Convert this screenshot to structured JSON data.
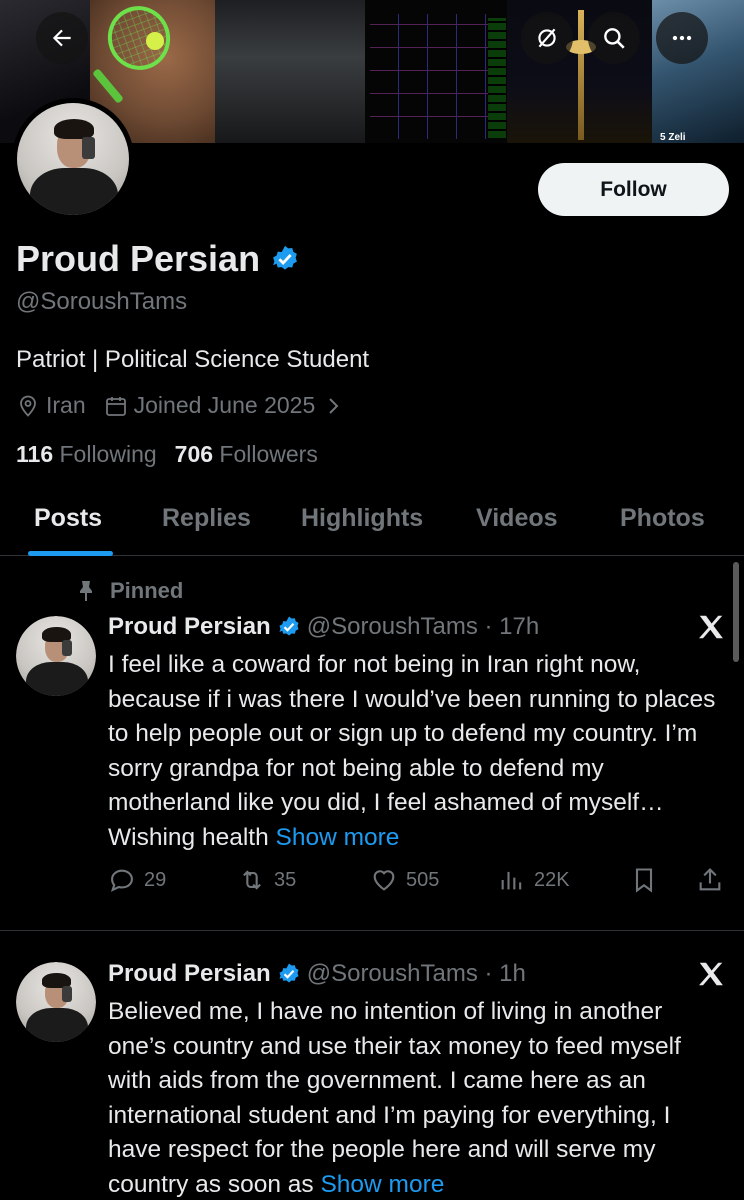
{
  "banner": {
    "overlay_text": "5 Zeli"
  },
  "header": {
    "back_icon": "arrow-left-icon",
    "actions": [
      "mute-icon",
      "search-icon",
      "more-icon"
    ]
  },
  "profile": {
    "follow_label": "Follow",
    "display_name": "Proud Persian",
    "verified": true,
    "handle": "@SoroushTams",
    "bio": "Patriot | Political Science Student",
    "location": "Iran",
    "joined": "Joined June 2025",
    "following_count": "116",
    "following_label": "Following",
    "followers_count": "706",
    "followers_label": "Followers"
  },
  "tabs": [
    {
      "label": "Posts",
      "active": true
    },
    {
      "label": "Replies",
      "active": false
    },
    {
      "label": "Highlights",
      "active": false
    },
    {
      "label": "Videos",
      "active": false
    },
    {
      "label": "Photos",
      "active": false
    }
  ],
  "posts": [
    {
      "pinned_label": "Pinned",
      "name": "Proud Persian",
      "handle_time": "@SoroushTams · 17h",
      "text": "I feel like a coward for not being in Iran right now, because if i was there I would’ve been running to places to help people out or sign up to defend my country. I’m sorry grandpa for not being able to defend my motherland like you did, I feel ashamed of myself… Wishing health ",
      "show_more": "Show more",
      "replies": "29",
      "reposts": "35",
      "likes": "505",
      "views": "22K"
    },
    {
      "name": "Proud Persian",
      "handle_time": "@SoroushTams · 1h",
      "text": "Believed me, I have no intention of living in another one’s country and use their tax money to feed myself with aids from the government. I came here as an international student and I’m paying for everything, I have respect for the people here and will serve my country as soon as ",
      "show_more": "Show more"
    }
  ],
  "colors": {
    "accent": "#1d9bf0",
    "background": "#000000",
    "text": "#e7e9ea",
    "muted": "#71767b"
  }
}
